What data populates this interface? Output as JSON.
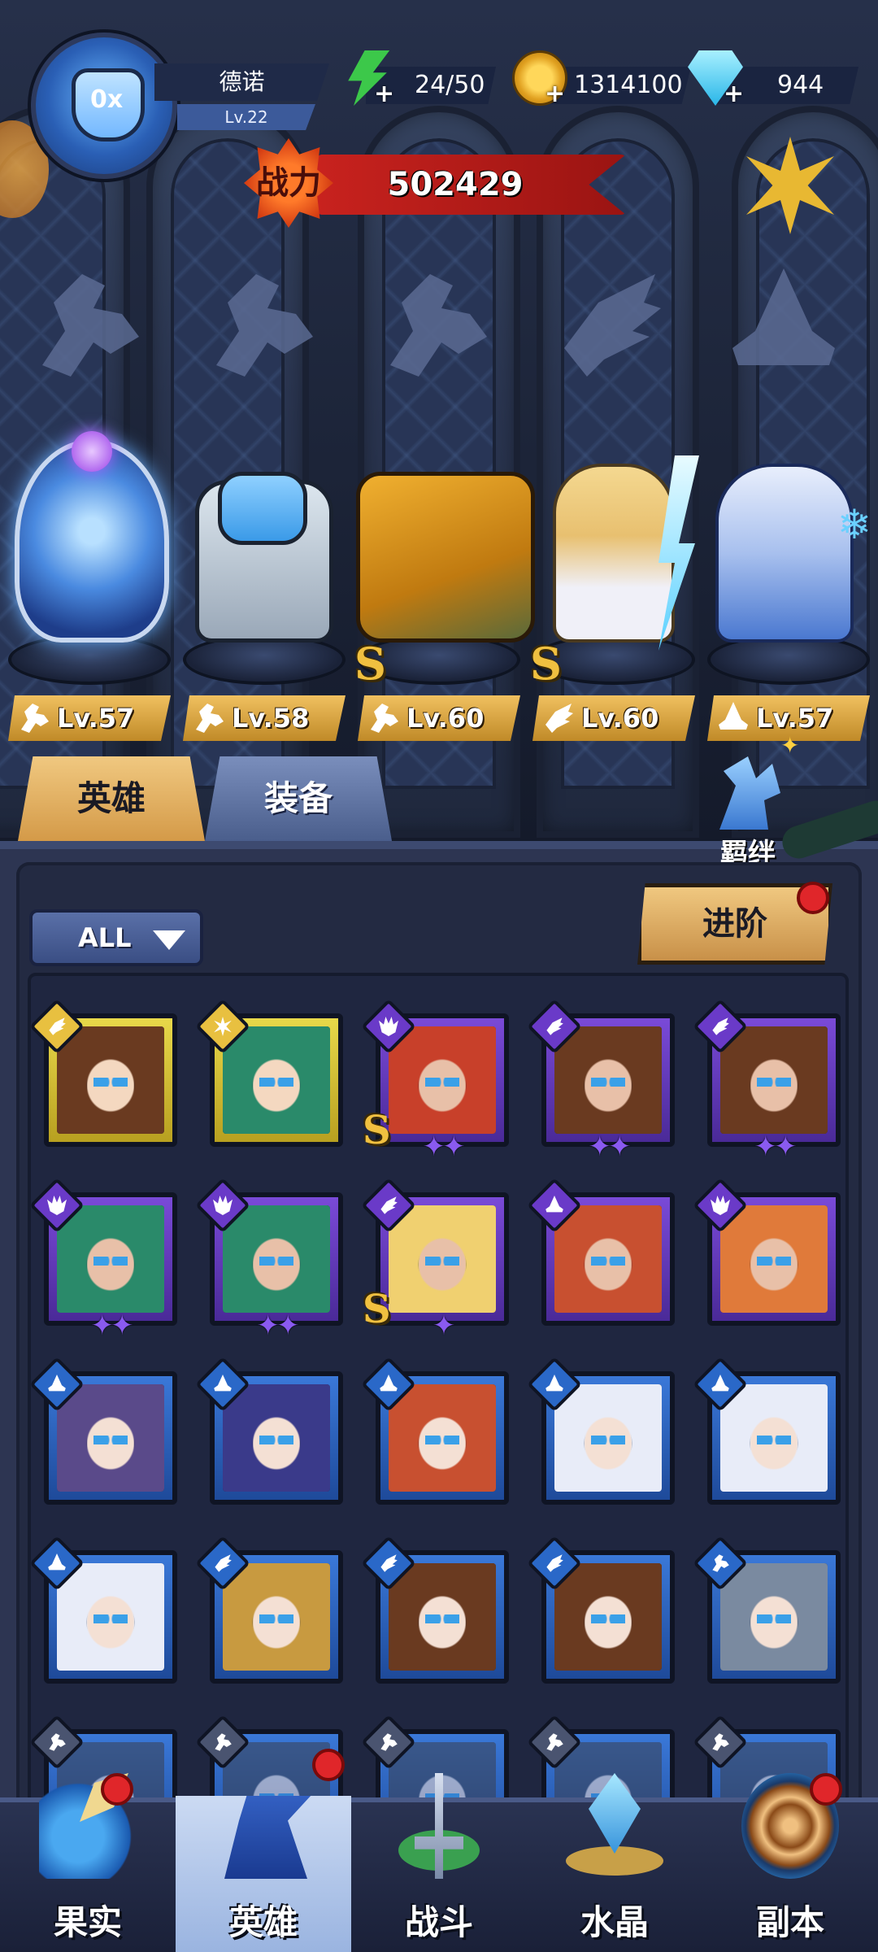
{
  "player": {
    "name": "德诺",
    "level": "Lv.22"
  },
  "resources": {
    "energy": "24/50",
    "coins": "1314100",
    "gems": "944"
  },
  "power": {
    "badge": "战力",
    "value": "502429"
  },
  "lineup": [
    {
      "level": "Lv.57",
      "class": "wrench",
      "rank": ""
    },
    {
      "level": "Lv.58",
      "class": "wrench",
      "rank": ""
    },
    {
      "level": "Lv.60",
      "class": "wrench",
      "rank": "S"
    },
    {
      "level": "Lv.60",
      "class": "wing",
      "rank": "S"
    },
    {
      "level": "Lv.57",
      "class": "hat",
      "rank": ""
    }
  ],
  "tabs": {
    "heroes": "英雄",
    "equipment": "装备",
    "bond": "羁绊"
  },
  "filter": {
    "selected": "ALL"
  },
  "advance_label": "进阶",
  "hero_cards": [
    {
      "frame": "gold",
      "class": "wing",
      "stars": "",
      "rank": ""
    },
    {
      "frame": "gold",
      "class": "sun",
      "stars": "",
      "rank": ""
    },
    {
      "frame": "purple",
      "class": "beast",
      "stars": "✦✦",
      "rank": "S"
    },
    {
      "frame": "purple",
      "class": "wing",
      "stars": "✦✦",
      "rank": ""
    },
    {
      "frame": "purple",
      "class": "wing",
      "stars": "✦✦",
      "rank": ""
    },
    {
      "frame": "purple",
      "class": "beast",
      "stars": "✦✦",
      "rank": ""
    },
    {
      "frame": "purple",
      "class": "beast",
      "stars": "✦✦",
      "rank": ""
    },
    {
      "frame": "purple",
      "class": "wing",
      "stars": "✦",
      "rank": "S"
    },
    {
      "frame": "purple",
      "class": "hat",
      "stars": "",
      "rank": ""
    },
    {
      "frame": "purple",
      "class": "beast",
      "stars": "",
      "rank": ""
    },
    {
      "frame": "blue",
      "class": "hat",
      "stars": "",
      "rank": ""
    },
    {
      "frame": "blue",
      "class": "hat",
      "stars": "",
      "rank": ""
    },
    {
      "frame": "blue",
      "class": "hat",
      "stars": "",
      "rank": ""
    },
    {
      "frame": "blue",
      "class": "hat",
      "stars": "",
      "rank": ""
    },
    {
      "frame": "blue",
      "class": "hat",
      "stars": "",
      "rank": ""
    },
    {
      "frame": "blue",
      "class": "hat",
      "stars": "",
      "rank": ""
    },
    {
      "frame": "blue",
      "class": "wing",
      "stars": "",
      "rank": ""
    },
    {
      "frame": "blue",
      "class": "wing",
      "stars": "",
      "rank": ""
    },
    {
      "frame": "blue",
      "class": "wing",
      "stars": "",
      "rank": ""
    },
    {
      "frame": "blue",
      "class": "wrench",
      "stars": "",
      "rank": ""
    },
    {
      "frame": "blue",
      "class": "wrench",
      "stars": "",
      "rank": ""
    },
    {
      "frame": "blue",
      "class": "wrench",
      "stars": "",
      "rank": ""
    },
    {
      "frame": "blue",
      "class": "wrench",
      "stars": "",
      "rank": ""
    },
    {
      "frame": "blue",
      "class": "wrench",
      "stars": "",
      "rank": ""
    },
    {
      "frame": "blue",
      "class": "wrench",
      "stars": "",
      "rank": ""
    }
  ],
  "nav": [
    {
      "label": "果实",
      "icon": "fruit-icon",
      "badge": true
    },
    {
      "label": "英雄",
      "icon": "hero-icon",
      "badge": true,
      "active": true
    },
    {
      "label": "战斗",
      "icon": "battle-icon",
      "badge": false
    },
    {
      "label": "水晶",
      "icon": "crystal-icon",
      "badge": false
    },
    {
      "label": "副本",
      "icon": "dungeon-icon",
      "badge": true
    }
  ],
  "colors": {
    "gold_frame": "#e8d84a",
    "purple_frame": "#7a4ad8",
    "blue_frame": "#3a78d8",
    "power_banner": "#c8221e",
    "notification": "#e0262a"
  }
}
